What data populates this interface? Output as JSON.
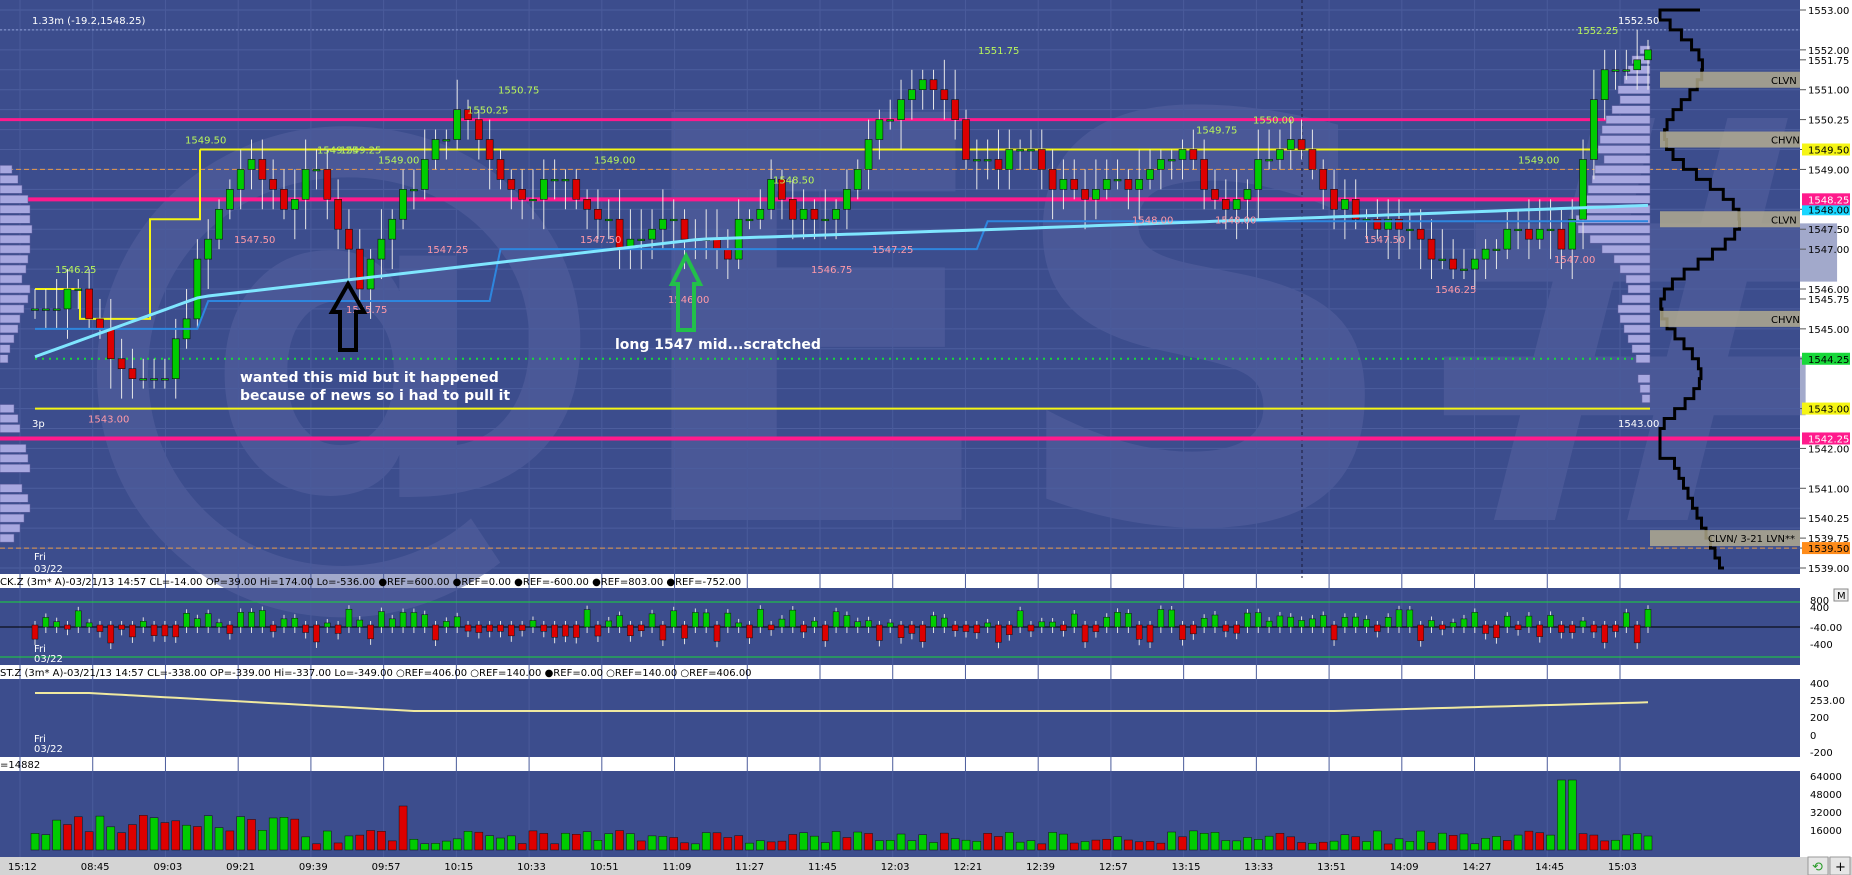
{
  "chart_info": {
    "top_info": "1.33m (-19.2,1548.25)",
    "top_price_right": "1552.50",
    "session_label": "3p",
    "day_label_1": "Fri",
    "day_label_2": "03/22",
    "low_right_label": "1543.00"
  },
  "watermark": "@ES#",
  "annotations": {
    "note_line1": "wanted this mid but it happened",
    "note_line2": "because of news so i had to pull it",
    "note_long": "long 1547 mid...scratched"
  },
  "panel2_header": "CK.Z (3m* A)-03/21/13 14:57 CL=-14.00 OP=39.00 Hi=174.00 Lo=-536.00 ●REF=600.00 ●REF=0.00 ●REF=-600.00 ●REF=803.00 ●REF=-752.00",
  "panel3_header": "ST.Z (3m* A)-03/21/13 14:57 CL=-338.00 OP=-339.00 Hi=-337.00 Lo=-349.00 ○REF=406.00 ○REF=140.00 ●REF=0.00 ○REF=140.00 ○REF=406.00",
  "panel4_header": "=14882",
  "colors": {
    "background": "#3c4d8d",
    "up_candle": "#00cc00",
    "down_candle": "#dd0000",
    "vwap": "#7fe6ff",
    "value_line": "#2e86de",
    "key_level": "#ff1a8c",
    "range_line": "#f5f514",
    "green_dotted": "#18d83a",
    "profile_bar": "#a8a8e0",
    "high_label": "#b8f55a",
    "low_label": "#ff9aa8"
  },
  "chart_data": [
    {
      "type": "candlestick",
      "y_range": [
        1539.0,
        1553.0
      ],
      "price_axis_labels": [
        "1553.00",
        "1552.00",
        "1551.75",
        "1551.00",
        "1550.25",
        "1549.50",
        "1549.00",
        "1548.00",
        "1547.50",
        "1547.00",
        "1546.00",
        "1545.75",
        "1545.00",
        "1544.25",
        "1543.00",
        "1542.00",
        "1541.00",
        "1540.25",
        "1539.75",
        "1539.50",
        "1539.00"
      ],
      "time_labels": [
        "15:12",
        "08:45",
        "09:03",
        "09:21",
        "09:39",
        "09:57",
        "10:15",
        "10:33",
        "10:51",
        "11:09",
        "11:27",
        "11:45",
        "12:03",
        "12:21",
        "12:39",
        "12:57",
        "13:15",
        "13:33",
        "13:51",
        "14:09",
        "14:27",
        "14:45",
        "15:03"
      ],
      "swing_highs": [
        {
          "label": "1546.25",
          "price": 1546.25
        },
        {
          "label": "1549.50",
          "price": 1549.5
        },
        {
          "label": "1549.25",
          "price": 1549.25
        },
        {
          "label": "1549.25",
          "price": 1549.25
        },
        {
          "label": "1549.00",
          "price": 1549.0
        },
        {
          "label": "1550.25",
          "price": 1550.25
        },
        {
          "label": "1550.75",
          "price": 1550.75
        },
        {
          "label": "1549.00",
          "price": 1549.0
        },
        {
          "label": "1548.50",
          "price": 1548.5
        },
        {
          "label": "1551.75",
          "price": 1551.75
        },
        {
          "label": "1549.75",
          "price": 1549.75
        },
        {
          "label": "1550.00",
          "price": 1550.0
        },
        {
          "label": "1549.00",
          "price": 1549.0
        },
        {
          "label": "1552.25",
          "price": 1552.25
        }
      ],
      "swing_lows": [
        {
          "label": "1543.00",
          "price": 1543.0
        },
        {
          "label": "1547.50",
          "price": 1547.5
        },
        {
          "label": "1545.75",
          "price": 1545.75
        },
        {
          "label": "1547.25",
          "price": 1547.25
        },
        {
          "label": "1547.50",
          "price": 1547.5
        },
        {
          "label": "1546.00",
          "price": 1546.0
        },
        {
          "label": "1546.75",
          "price": 1546.75
        },
        {
          "label": "1547.25",
          "price": 1547.25
        },
        {
          "label": "1548.00",
          "price": 1548.0
        },
        {
          "label": "1548.00",
          "price": 1548.0
        },
        {
          "label": "1547.50",
          "price": 1547.5
        },
        {
          "label": "1546.25",
          "price": 1546.25
        },
        {
          "label": "1547.00",
          "price": 1547.0
        }
      ],
      "levels": [
        {
          "name": "yellow-high",
          "price": 1549.5
        },
        {
          "name": "yellow-low",
          "price": 1543.0
        },
        {
          "name": "magenta-top",
          "price": 1550.25
        },
        {
          "name": "magenta-mid",
          "price": 1548.25
        },
        {
          "name": "magenta-low",
          "price": 1542.25
        },
        {
          "name": "green-dotted",
          "price": 1544.25
        }
      ],
      "profile_tags": [
        {
          "label": "CLVN",
          "price": 1551.25
        },
        {
          "label": "CHVN",
          "price": 1549.75
        },
        {
          "label": "CLVN",
          "price": 1547.75
        },
        {
          "label": "CHVN",
          "price": 1545.25
        },
        {
          "label": "CLVN/ 3-21 LVN**",
          "price": 1539.75
        }
      ]
    },
    {
      "type": "bar",
      "name": "CK.Z",
      "axis_labels": [
        "800",
        "400",
        "-40.00",
        "-400"
      ],
      "ref_levels": [
        600,
        0,
        -600,
        803,
        -752
      ]
    },
    {
      "type": "line",
      "name": "ST.Z",
      "axis_labels": [
        "400",
        "253.00",
        "200",
        "0",
        "-200"
      ]
    },
    {
      "type": "bar",
      "name": "Volume",
      "axis_labels": [
        "64000",
        "48000",
        "32000",
        "16000"
      ]
    }
  ]
}
